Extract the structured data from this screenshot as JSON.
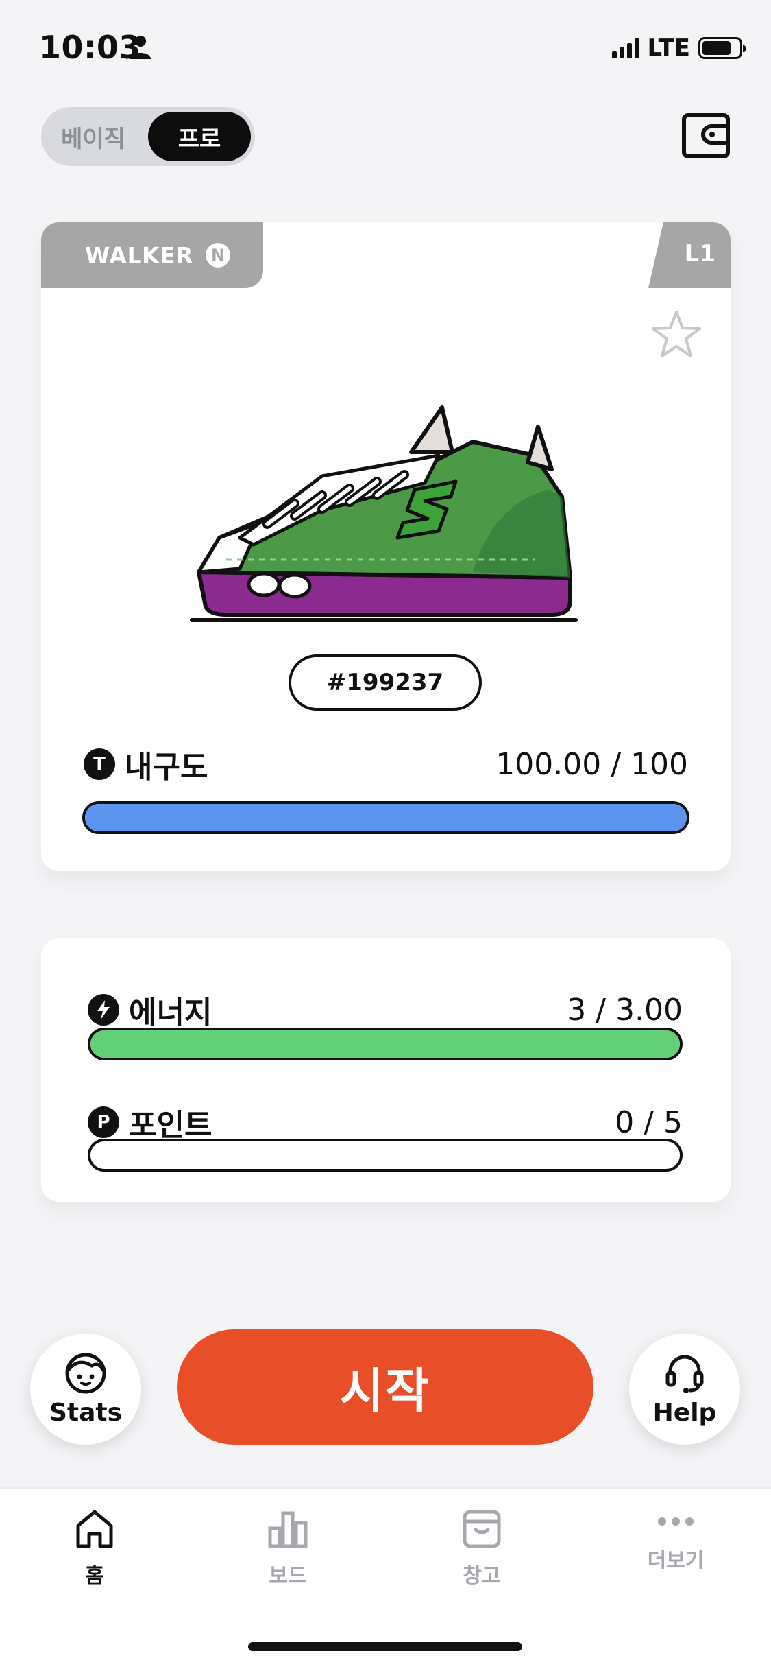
{
  "status_bar": {
    "time": "10:03",
    "network": "LTE"
  },
  "mode_toggle": {
    "basic_label": "베이직",
    "pro_label": "프로",
    "selected": "프로"
  },
  "sneaker": {
    "class": "WALKER",
    "class_badge": "N",
    "level": "L1",
    "id": "#199237",
    "colors": {
      "upper": "#4c9a48",
      "sole": "#8b2a8f",
      "logo": "#3ca23a"
    }
  },
  "durability": {
    "label": "내구도",
    "value": "100.00 / 100",
    "fraction": 1.0,
    "color": "#5b95ef"
  },
  "energy": {
    "label": "에너지",
    "value": "3 / 3.00",
    "fraction": 1.0,
    "color": "#63cf78"
  },
  "points": {
    "label": "포인트",
    "icon": "P",
    "value": "0 / 5",
    "fraction": 0.0,
    "color": "#63cf78"
  },
  "actions": {
    "stats_label": "Stats",
    "start_label": "시작",
    "help_label": "Help",
    "start_color": "#e84e28"
  },
  "tabs": [
    {
      "label": "홈",
      "icon": "home-icon",
      "active": true
    },
    {
      "label": "보드",
      "icon": "bar-chart-icon",
      "active": false
    },
    {
      "label": "창고",
      "icon": "storage-box-icon",
      "active": false
    },
    {
      "label": "더보기",
      "icon": "more-dots-icon",
      "active": false
    }
  ]
}
